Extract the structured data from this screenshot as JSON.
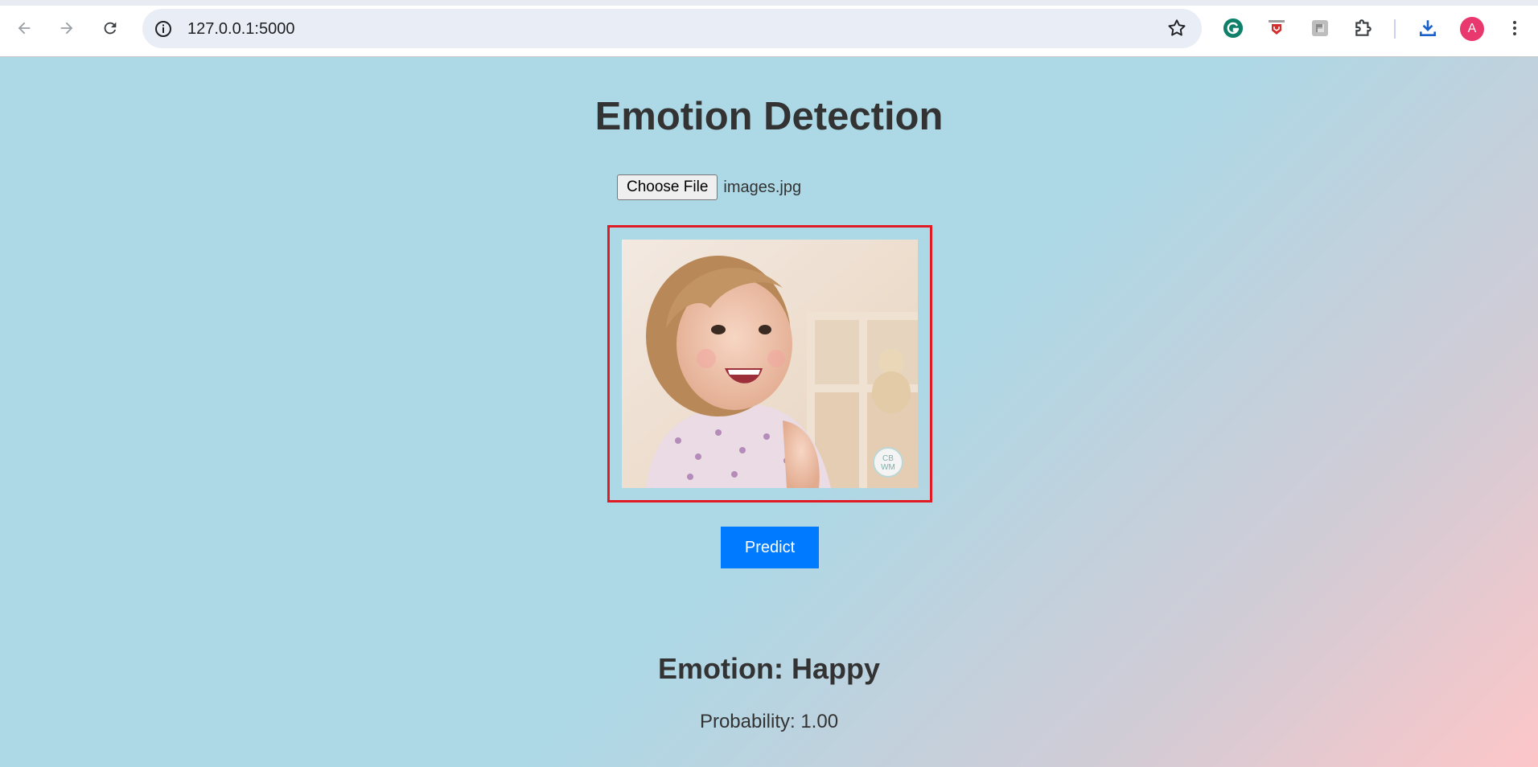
{
  "browser": {
    "url": "127.0.0.1:5000",
    "avatar_letter": "A",
    "extensions": [
      "grammarly-icon",
      "pdf-extension-icon",
      "python-extension-icon",
      "puzzle-extensions-icon"
    ]
  },
  "page": {
    "title": "Emotion Detection",
    "file_button_label": "Choose File",
    "file_name": "images.jpg",
    "predict_label": "Predict",
    "emotion_text": "Emotion: Happy",
    "probability_text": "Probability: 1.00",
    "watermark_line1": "CB",
    "watermark_line2": "WM"
  },
  "colors": {
    "accent_button": "#007bff",
    "image_frame": "#e01b24",
    "background_start": "#add8e6",
    "background_end": "#fdc6c8"
  }
}
